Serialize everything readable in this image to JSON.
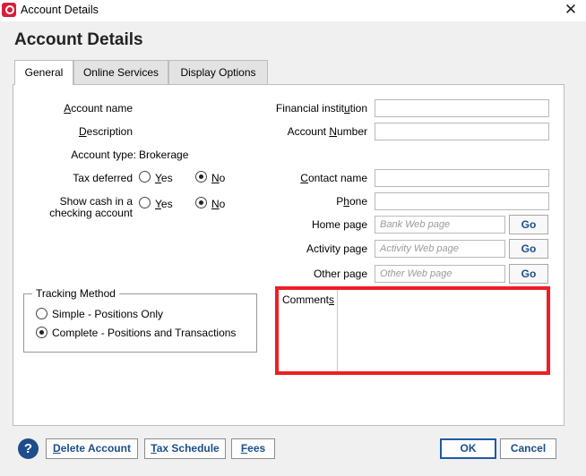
{
  "window": {
    "title": "Account Details",
    "close_glyph": "✕"
  },
  "dialog": {
    "heading": "Account Details"
  },
  "tabs": [
    {
      "label": "General",
      "active": true
    },
    {
      "label": "Online Services",
      "active": false
    },
    {
      "label": "Display Options",
      "active": false
    }
  ],
  "left": {
    "account_name": {
      "pre": "",
      "u": "A",
      "post": "ccount name"
    },
    "description": {
      "pre": "",
      "u": "D",
      "post": "escription"
    },
    "account_type_label": "Account type:",
    "account_type_value": "Brokerage",
    "tax_deferred_label": "Tax deferred",
    "show_cash_line1": "Show cash in a",
    "show_cash_line2": "checking account",
    "yes": {
      "pre": "",
      "u": "Y",
      "post": "es"
    },
    "no": {
      "pre": "",
      "u": "N",
      "post": "o"
    },
    "tax_deferred_value": "No",
    "show_cash_value": "No"
  },
  "tracking": {
    "legend": "Tracking Method",
    "options": [
      {
        "label": "Simple - Positions Only",
        "selected": false
      },
      {
        "label": "Complete - Positions and Transactions",
        "selected": true
      }
    ]
  },
  "right": {
    "financial_institution": {
      "pre": "Financial instit",
      "u": "u",
      "post": "tion"
    },
    "account_number": {
      "pre": "Account ",
      "u": "N",
      "post": "umber"
    },
    "contact_name": {
      "pre": "",
      "u": "C",
      "post": "ontact name"
    },
    "phone": {
      "pre": "P",
      "u": "h",
      "post": "one"
    },
    "home_page": {
      "label": "Home page",
      "placeholder": "Bank Web page"
    },
    "activity_page": {
      "label": "Activity page",
      "placeholder": "Activity Web page"
    },
    "other_page": {
      "label": "Other page",
      "placeholder": "Other Web page"
    },
    "go_label": "Go",
    "comments": {
      "pre": "Comment",
      "u": "s",
      "post": ""
    }
  },
  "footer": {
    "help_glyph": "?",
    "delete_account": {
      "pre": "",
      "u": "D",
      "post": "elete Account"
    },
    "tax_schedule": {
      "pre": "",
      "u": "T",
      "post": "ax Schedule"
    },
    "fees": {
      "pre": "",
      "u": "F",
      "post": "ees"
    },
    "ok": "OK",
    "cancel": "Cancel"
  },
  "colors": {
    "highlight_border": "#ee1f25",
    "button_text": "#1b4f8a",
    "brand_icon": "#d81e3a"
  }
}
